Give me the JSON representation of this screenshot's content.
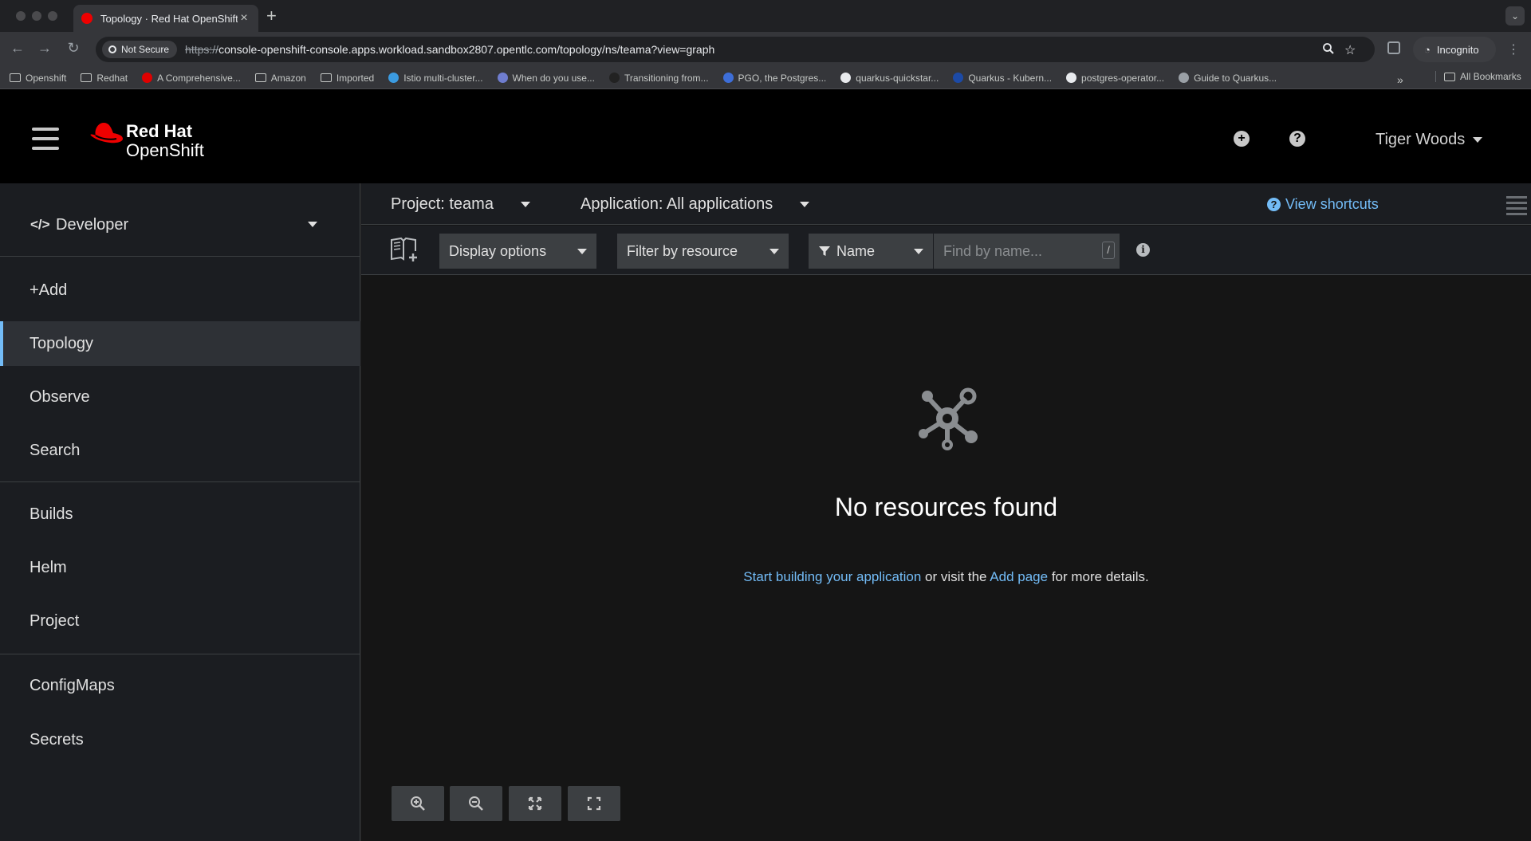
{
  "browser": {
    "tab_title": "Topology · Red Hat OpenShift",
    "security_label": "Not Secure",
    "url_scheme": "https://",
    "url_rest": "console-openshift-console.apps.workload.sandbox2807.opentlc.com/topology/ns/teama?view=graph",
    "incognito_label": "Incognito",
    "bookmarks": [
      {
        "label": "Openshift",
        "icon": "folder-icon"
      },
      {
        "label": "Redhat",
        "icon": "folder-icon"
      },
      {
        "label": "A Comprehensive...",
        "icon": "site-icon",
        "color": "#e00000"
      },
      {
        "label": "Amazon",
        "icon": "folder-icon"
      },
      {
        "label": "Imported",
        "icon": "folder-icon"
      },
      {
        "label": "Istio multi-cluster...",
        "icon": "site-icon",
        "color": "#3b9be0"
      },
      {
        "label": "When do you use...",
        "icon": "site-icon",
        "color": "#6f7dcf"
      },
      {
        "label": "Transitioning from...",
        "icon": "site-icon",
        "color": "#222222"
      },
      {
        "label": "PGO, the Postgres...",
        "icon": "site-icon",
        "color": "#3d6ed8"
      },
      {
        "label": "quarkus-quickstar...",
        "icon": "github-icon",
        "color": "#e8eaed"
      },
      {
        "label": "Quarkus - Kubern...",
        "icon": "site-icon",
        "color": "#1c4aa6"
      },
      {
        "label": "postgres-operator...",
        "icon": "github-icon",
        "color": "#e8eaed"
      },
      {
        "label": "Guide to Quarkus...",
        "icon": "site-icon",
        "color": "#9aa0a6"
      }
    ],
    "bookmarks_overflow": "»",
    "all_bookmarks": "All Bookmarks"
  },
  "masthead": {
    "brand_line1": "Red Hat",
    "brand_line2": "OpenShift",
    "user_name": "Tiger Woods",
    "brand_color": "#ee0000"
  },
  "sidebar": {
    "perspective_icon": "</>",
    "perspective": "Developer",
    "items": [
      {
        "label": "+Add"
      },
      {
        "label": "Topology",
        "active": true
      },
      {
        "label": "Observe"
      },
      {
        "label": "Search"
      },
      {
        "label": "Builds"
      },
      {
        "label": "Helm"
      },
      {
        "label": "Project"
      },
      {
        "label": "ConfigMaps"
      },
      {
        "label": "Secrets"
      }
    ]
  },
  "toolbar": {
    "project_label": "Project: teama",
    "application_label": "Application: All applications",
    "view_shortcuts": "View shortcuts",
    "display_options": "Display options",
    "filter_by_resource": "Filter by resource",
    "name_filter": "Name",
    "search_placeholder": "Find by name...",
    "search_shortcut": "/",
    "accent_color": "#73bcf7"
  },
  "empty_state": {
    "title": "No resources found",
    "link_start": "Start building your application",
    "text_middle": " or visit the ",
    "link_add": "Add page",
    "text_end": " for more details."
  },
  "zoom_controls": [
    "zoom-in-icon",
    "zoom-out-icon",
    "fit-to-screen-icon",
    "reset-view-icon"
  ]
}
